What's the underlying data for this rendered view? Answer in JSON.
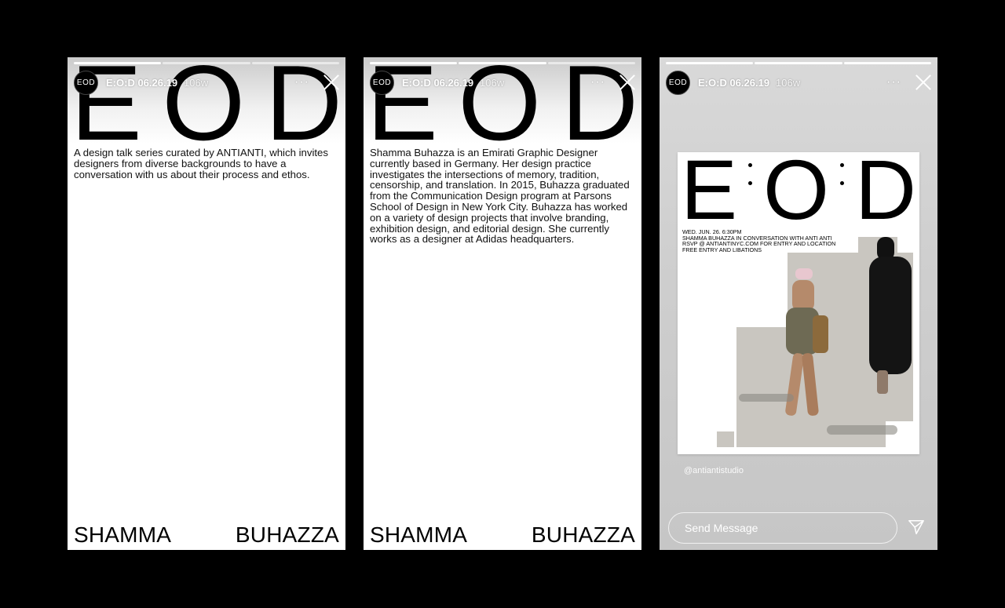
{
  "stories": [
    {
      "avatar_text": "EOD",
      "username": "E:O:D 06.26.19",
      "age": "106w",
      "more": "···",
      "big_letters": [
        "E",
        "O",
        "D"
      ],
      "body": "A design talk series curated by ANTIANTI, which invites designers from diverse backgrounds to have a conversation with us about their process and ethos.",
      "footer_left": "SHAMMA",
      "footer_right": "BUHAZZA"
    },
    {
      "avatar_text": "EOD",
      "username": "E:O:D 06.26.19",
      "age": "106w",
      "more": "···",
      "big_letters": [
        "E",
        "O",
        "D"
      ],
      "body": "Shamma Buhazza is an Emirati Graphic Designer currently based in Germany. Her design practice investigates the intersections of memory, tradition, censorship, and translation. In 2015, Buhazza graduated from the Communication Design program at Parsons School of Design in New York City. Buhazza has worked on a variety of design projects that involve branding, exhibition design, and editorial design. She currently works as a designer at Adidas headquarters.",
      "footer_left": "SHAMMA",
      "footer_right": "BUHAZZA"
    },
    {
      "avatar_text": "EOD",
      "username": "E:O:D 06.26.19",
      "age": "106w",
      "more": "···",
      "poster": {
        "letters": [
          "E",
          "O",
          "D"
        ],
        "info_lines": [
          "WED. JUN. 26. 6:30PM",
          "SHAMMA BUHAZZA IN CONVERSATION WITH ANTI ANTI",
          "RSVP @ ANTIANTINYC.COM FOR ENTRY AND LOCATION",
          "FREE ENTRY AND LIBATIONS"
        ]
      },
      "handle": "@antiantistudio",
      "message_placeholder": "Send Message"
    }
  ],
  "colors": {
    "background": "#000000",
    "story_bg": "#ffffff",
    "text": "#111111"
  }
}
